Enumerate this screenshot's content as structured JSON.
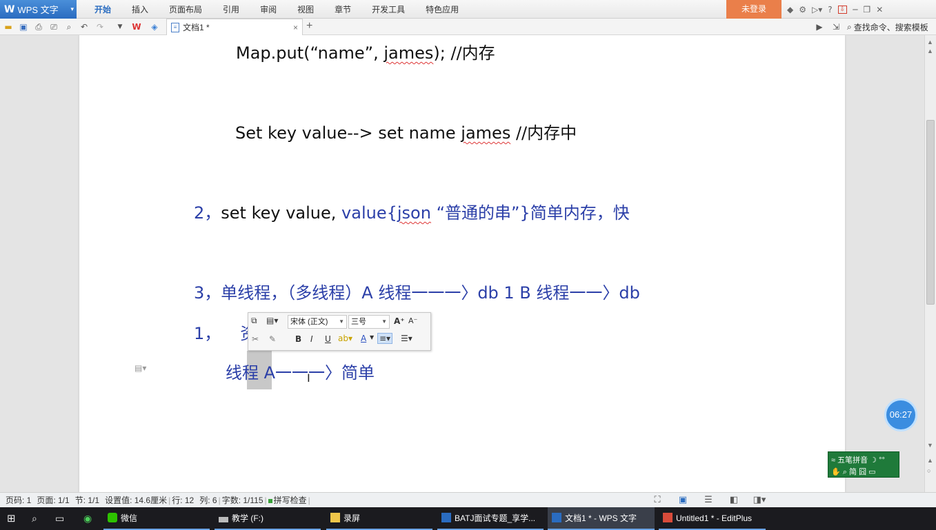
{
  "app": {
    "logo_letter": "W",
    "title": "WPS 文字",
    "caret": "▾"
  },
  "menu": {
    "tabs": [
      "开始",
      "插入",
      "页面布局",
      "引用",
      "审阅",
      "视图",
      "章节",
      "开发工具",
      "特色应用"
    ],
    "login_label": "未登录",
    "help_label": "?"
  },
  "toolbar": {
    "doc_tab_title": "文档1 *",
    "doc_tab_close": "×",
    "new_tab": "+",
    "search_label": "查找命令、搜索模板"
  },
  "document": {
    "line1": {
      "code": "Map.put(“name”, ",
      "squiggle": "james",
      "rest": "); //内存"
    },
    "line2": {
      "code": "Set key value--> set name ",
      "squiggle": "james",
      "rest": "    //内存中"
    },
    "line3": {
      "num": "2，",
      "text": "set key value,    ",
      "blue1": "value{",
      "squiggle": "json",
      "blue2": " “普通的串”}简单内存，快"
    },
    "line4": {
      "text": "3，单线程，（多线程）A 线程一一一〉db 1    B 线程一一〉db"
    },
    "line5": {
      "num": "1，",
      "partial": "资"
    },
    "line6": {
      "text": "线程 A一一一〉简单"
    }
  },
  "mini_toolbar": {
    "font_name": "宋体 (正文)",
    "font_size": "三号",
    "grow": "A⁺",
    "shrink": "A⁻",
    "bold": "B",
    "italic": "I",
    "underline": "U",
    "font_color": "A"
  },
  "timer": "06:27",
  "ime": {
    "row1": "五笔拼音",
    "row2_a": "简",
    "row2_b": "囧"
  },
  "statusbar": {
    "page_num": "页码: 1",
    "page_count": "页面: 1/1",
    "section": "节: 1/1",
    "setting": "设置值: 14.6厘米",
    "row": "行: 12",
    "col": "列: 6",
    "words": "字数: 1/115",
    "spell": "拼写检查"
  },
  "taskbar": {
    "wechat": "微信",
    "items": [
      {
        "label": "教学 (F:)"
      },
      {
        "label": "录屏"
      },
      {
        "label": "BATJ面试专题_享学..."
      },
      {
        "label": "文档1 * - WPS 文字"
      },
      {
        "label": "Untitled1 * - EditPlus"
      }
    ]
  },
  "colors": {
    "accent_blue": "#2a6cc0",
    "login_orange": "#ea7f4a",
    "doc_blue_text": "#2b3fa8",
    "ime_green": "#1f7a3a",
    "timer_blue": "#3b8de0"
  }
}
